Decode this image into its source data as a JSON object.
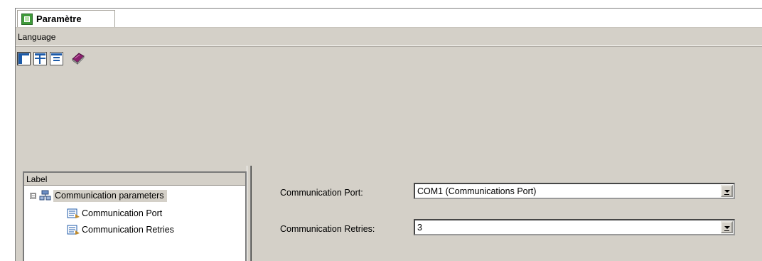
{
  "tab": {
    "title": "Paramètre",
    "icon": "parameter-window-icon"
  },
  "menu": {
    "language": "Language"
  },
  "toolbar": {
    "buttons": [
      {
        "icon": "layout-left-pane-icon"
      },
      {
        "icon": "layout-top-pane-icon"
      },
      {
        "icon": "layout-list-pane-icon"
      },
      {
        "icon": "book-icon"
      }
    ]
  },
  "tree": {
    "header": "Label",
    "root": {
      "label": "Communication parameters",
      "expander": "⊟",
      "icon": "device-tree-icon"
    },
    "children": [
      {
        "label": "Communication Port",
        "icon": "parameter-leaf-icon"
      },
      {
        "label": "Communication Retries",
        "icon": "parameter-leaf-icon"
      }
    ]
  },
  "form": {
    "port": {
      "label": "Communication Port:",
      "value": "COM1 (Communications Port)"
    },
    "retries": {
      "label": "Communication Retries:",
      "value": "3"
    }
  },
  "colors": {
    "panel_bg": "#d4d0c8",
    "accent_blue": "#1c5aa8",
    "tab_green": "#3f9a3a",
    "book_purple": "#8a1f6e"
  }
}
